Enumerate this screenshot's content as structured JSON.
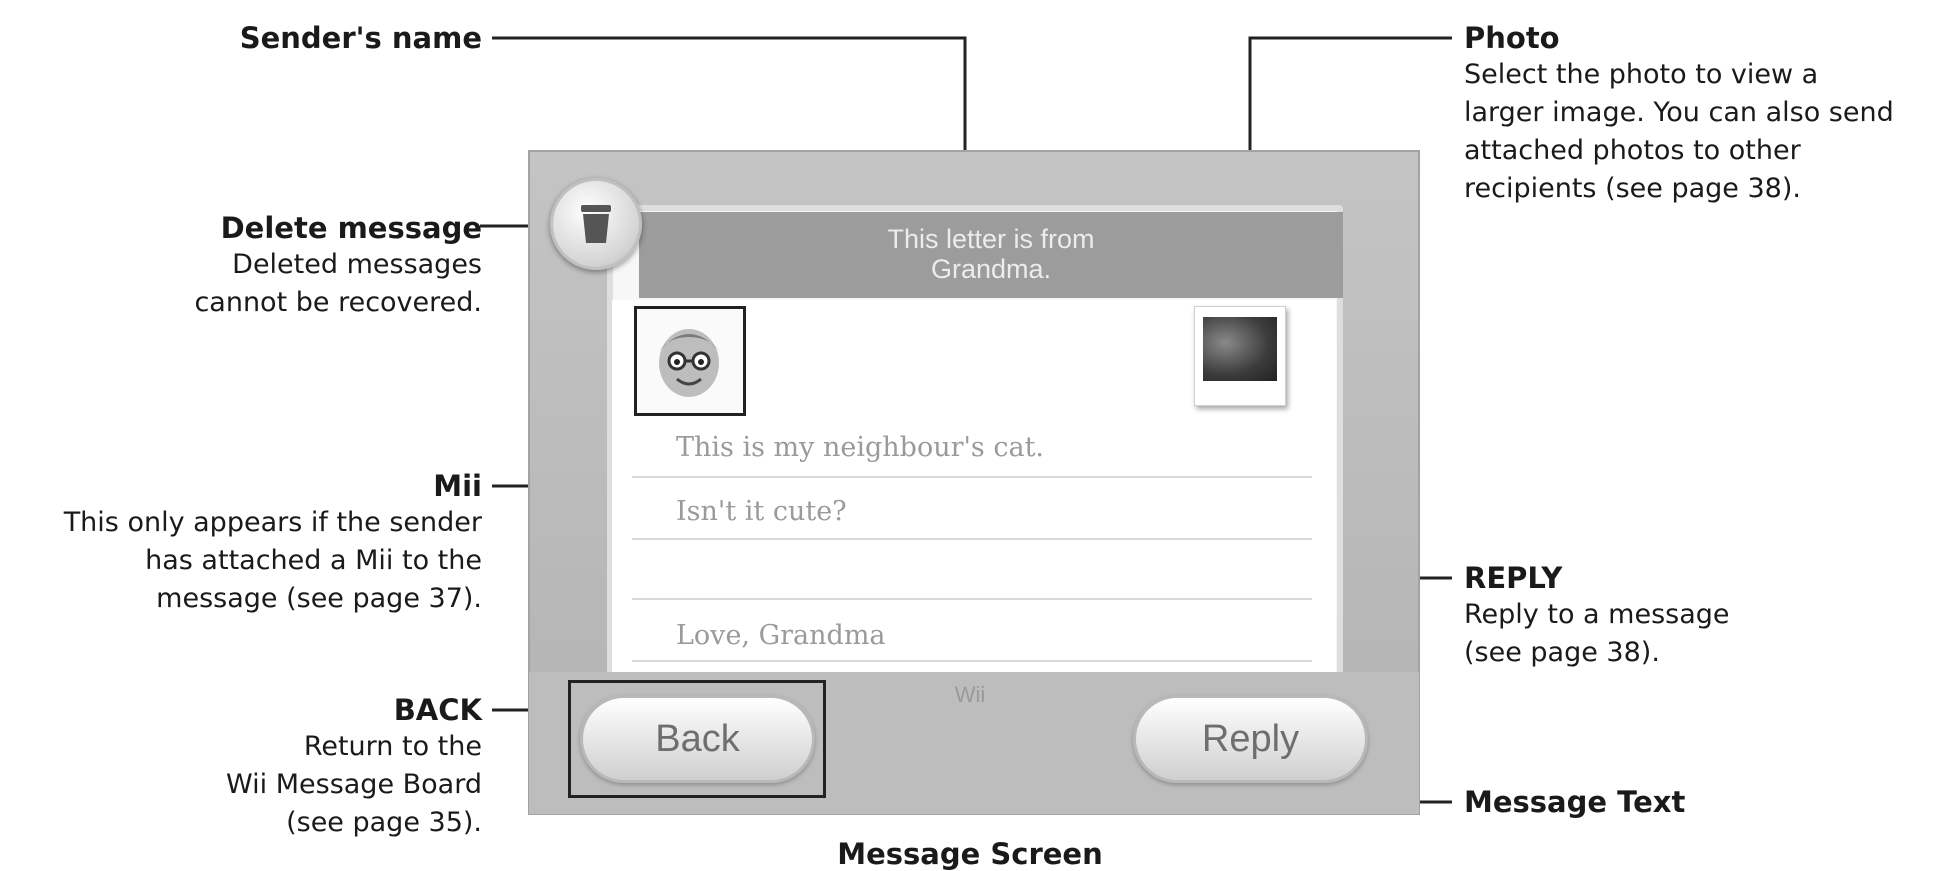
{
  "callouts": {
    "sender": {
      "title": "Sender's name"
    },
    "delete": {
      "title": "Delete message",
      "desc": [
        "Deleted messages",
        "cannot be recovered."
      ]
    },
    "mii": {
      "title": "Mii",
      "desc": [
        "This only appears if the sender",
        "has attached a Mii to the",
        "message (see page 37)."
      ]
    },
    "back": {
      "title": "BACK",
      "desc": [
        "Return to the",
        "Wii Message Board",
        "(see page 35)."
      ]
    },
    "photo": {
      "title": "Photo",
      "desc": [
        "Select the photo to view a",
        "larger image. You can also send",
        "attached photos to other",
        "recipients (see page 38)."
      ]
    },
    "reply": {
      "title": "REPLY",
      "desc": [
        "Reply to a message",
        "(see page 38)."
      ]
    },
    "message_text": {
      "title": "Message Text"
    }
  },
  "screen": {
    "header": [
      "This letter is from",
      "Grandma."
    ],
    "message_lines": [
      "This is my neighbour's cat.",
      "Isn't it cute?",
      "",
      "Love, Grandma"
    ],
    "wii_label": "Wii",
    "back_label": "Back",
    "reply_label": "Reply"
  },
  "caption": "Message Screen",
  "colors": {
    "panel_header": "#9c9c9c",
    "frame": "#b8b8b8",
    "leader": "#222222"
  },
  "icons": [
    "trash-icon",
    "mii-face-icon",
    "photo-thumbnail"
  ]
}
